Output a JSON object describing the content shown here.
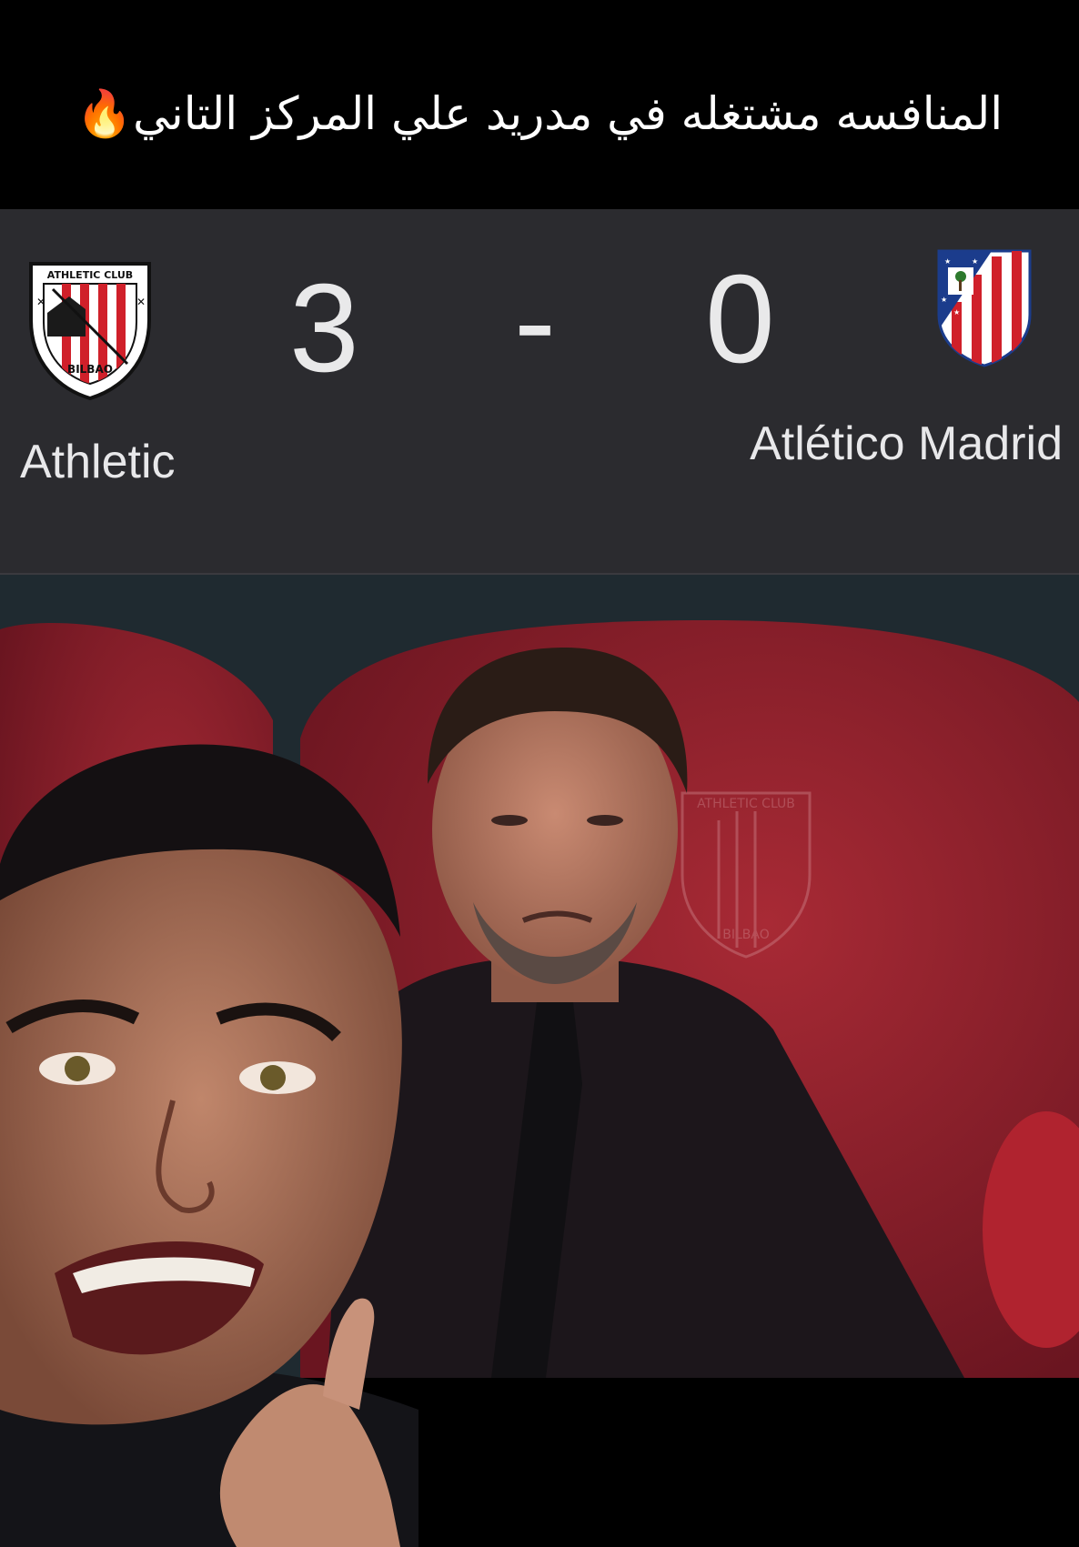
{
  "caption": {
    "text": "المنافسه مشتغله في مدريد علي المركز التاني",
    "emoji": "🔥"
  },
  "match": {
    "home": {
      "name": "Athletic",
      "score": "3",
      "crest_text_top": "ATHLETIC CLUB",
      "crest_text_bottom": "BILBAO"
    },
    "separator": "-",
    "away": {
      "name": "Atlético Madrid",
      "score": "0"
    }
  },
  "photo": {
    "background_crest_top": "ATHLETIC CLUB",
    "background_crest_bottom": "BILBAO"
  },
  "colors": {
    "scorecard_bg": "#2b2b2f",
    "seat_red": "#8e1f2a",
    "athletic_red": "#d0202a",
    "atletico_blue": "#1b3c8c"
  }
}
